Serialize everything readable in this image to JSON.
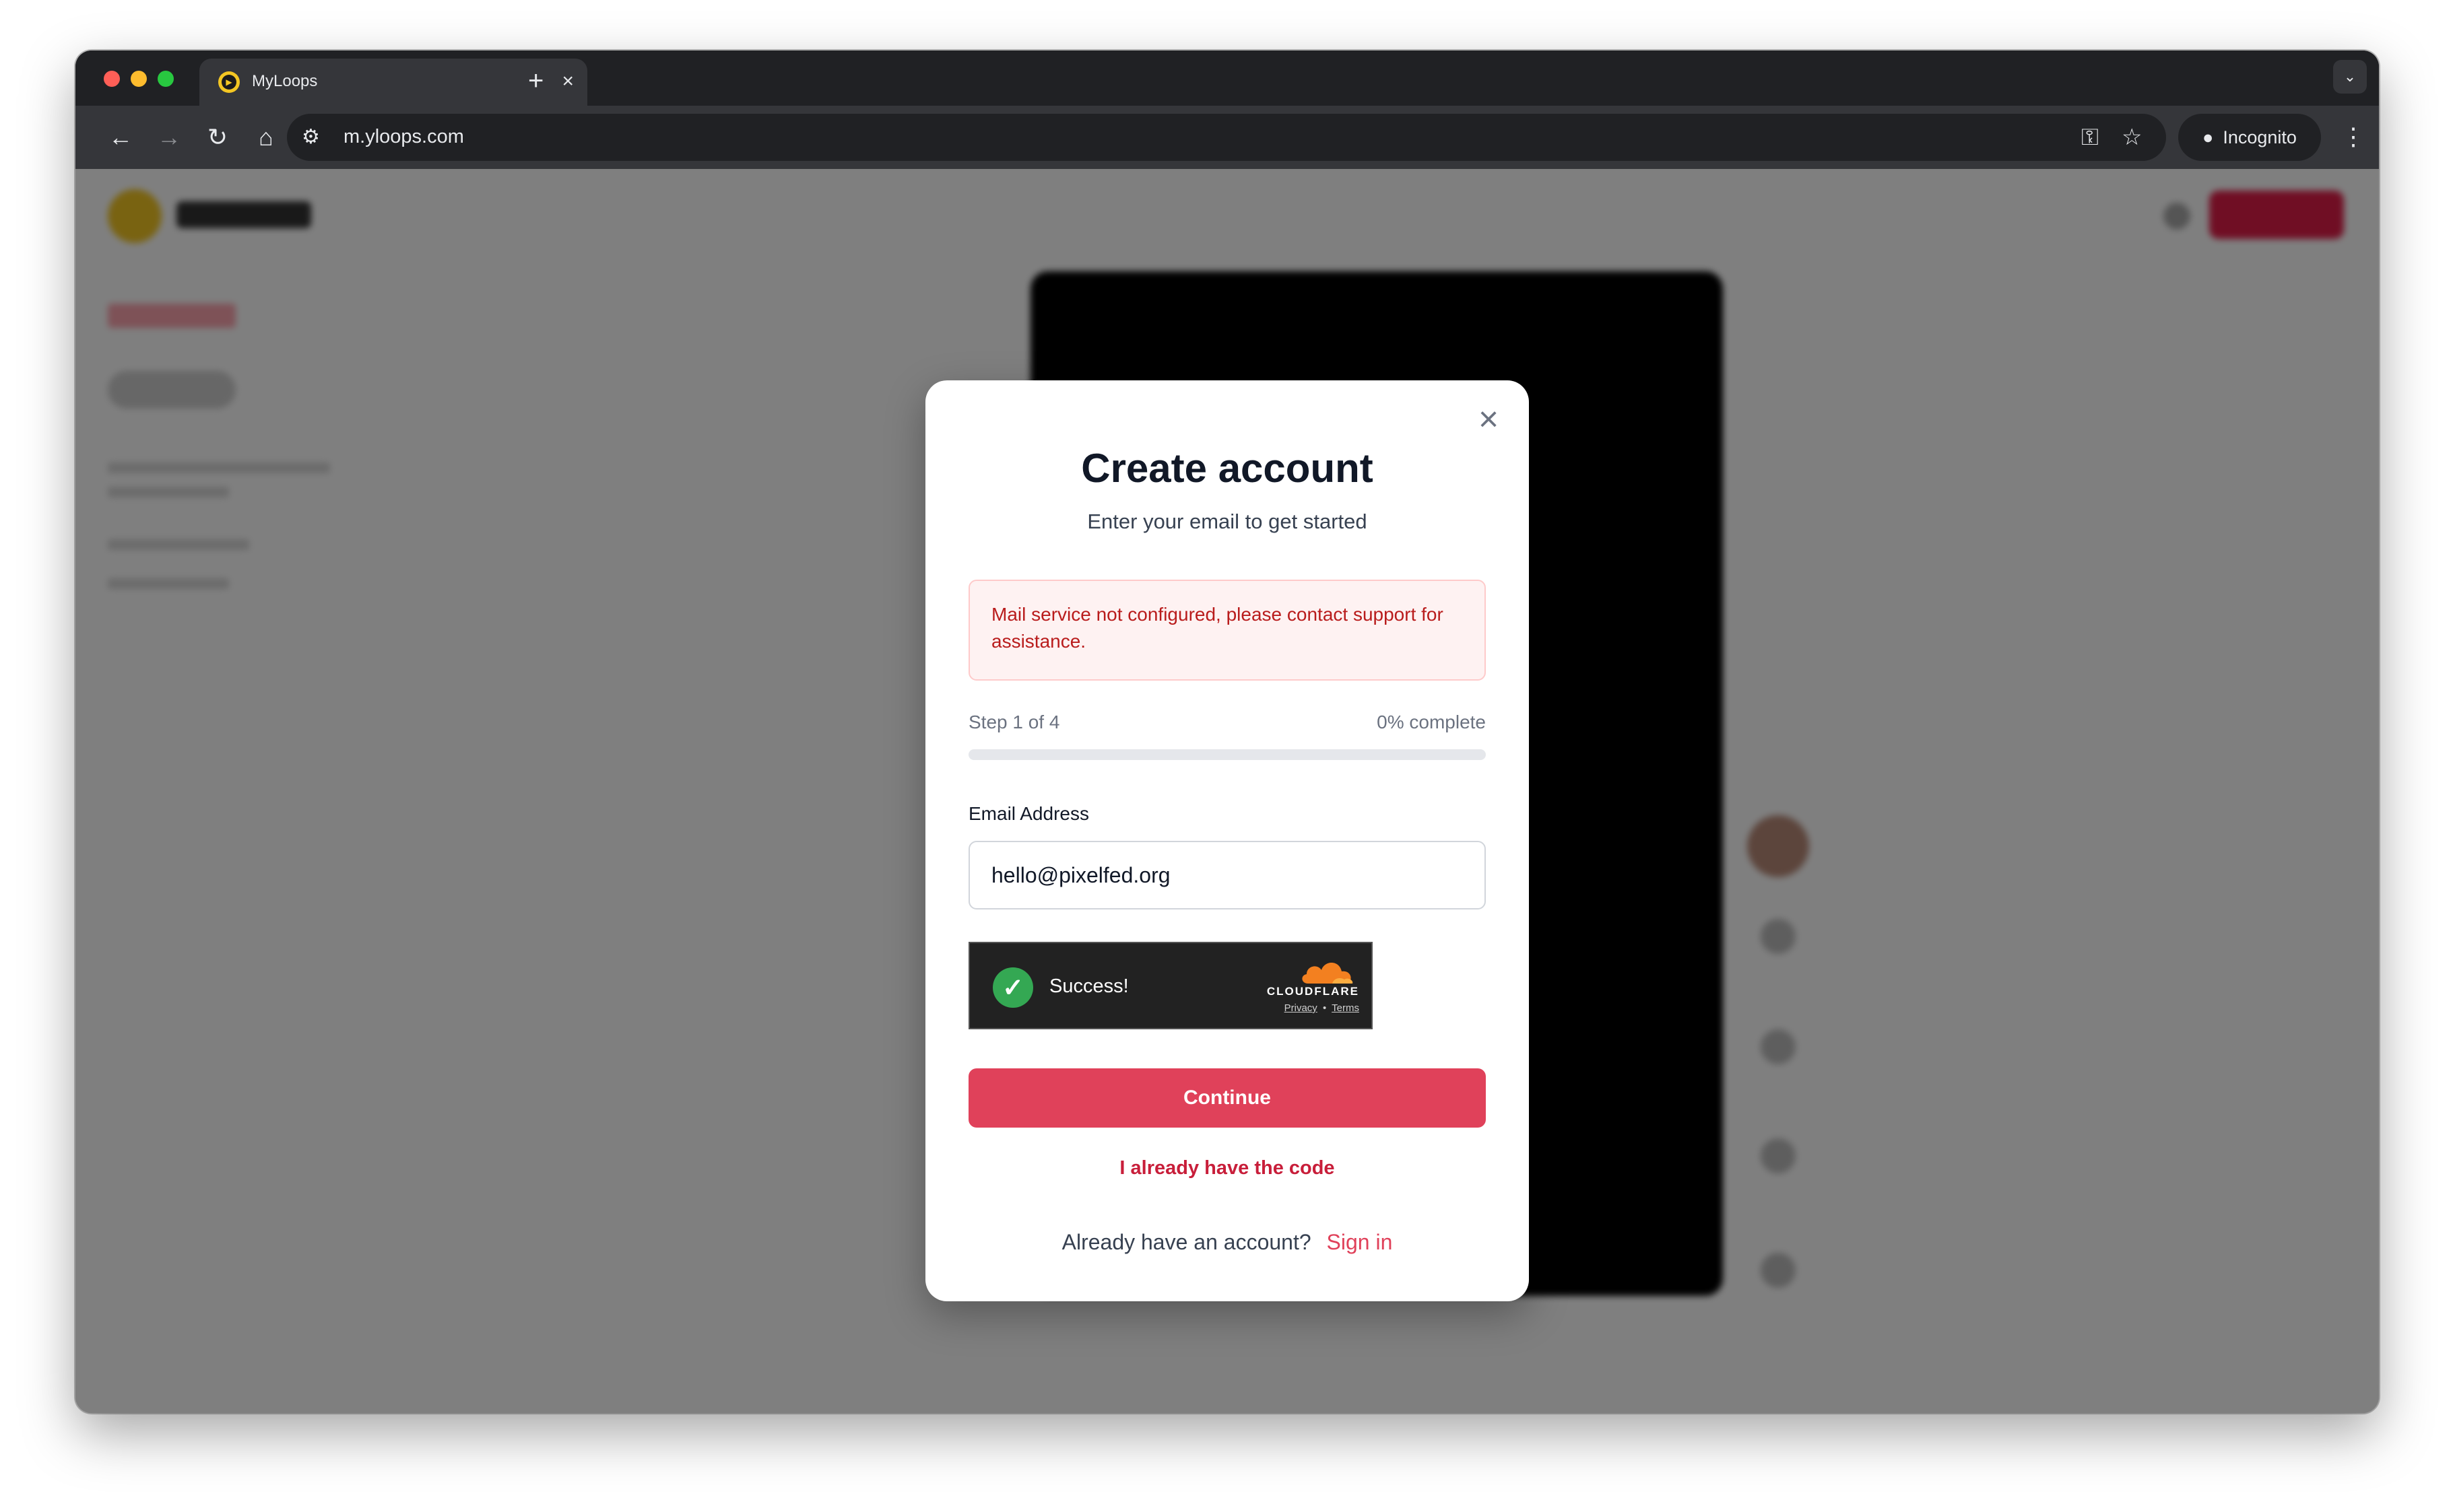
{
  "browser": {
    "tab": {
      "title": "MyLoops",
      "favicon": "myloops-play-icon"
    },
    "toolbar": {
      "url": "m.yloops.com",
      "incognito_label": "Incognito"
    }
  },
  "modal": {
    "title": "Create account",
    "subtitle": "Enter your email to get started",
    "error_message": "Mail service not configured, please contact support for assistance.",
    "progress": {
      "step_label": "Step 1 of 4",
      "percent_label": "0% complete",
      "value": 0
    },
    "email": {
      "label": "Email Address",
      "value": "hello@pixelfed.org"
    },
    "captcha": {
      "status": "Success!",
      "brand": "CLOUDFLARE",
      "privacy_link": "Privacy",
      "separator": "•",
      "terms_link": "Terms"
    },
    "continue_label": "Continue",
    "code_link_label": "I already have the code",
    "signin_prompt": "Already have an account?",
    "signin_link": "Sign in"
  },
  "colors": {
    "accent": "#e0415a",
    "error_text": "#b91c1c",
    "error_bg": "#fef2f2",
    "captcha_success": "#34a853",
    "cloudflare_orange": "#f38020"
  }
}
